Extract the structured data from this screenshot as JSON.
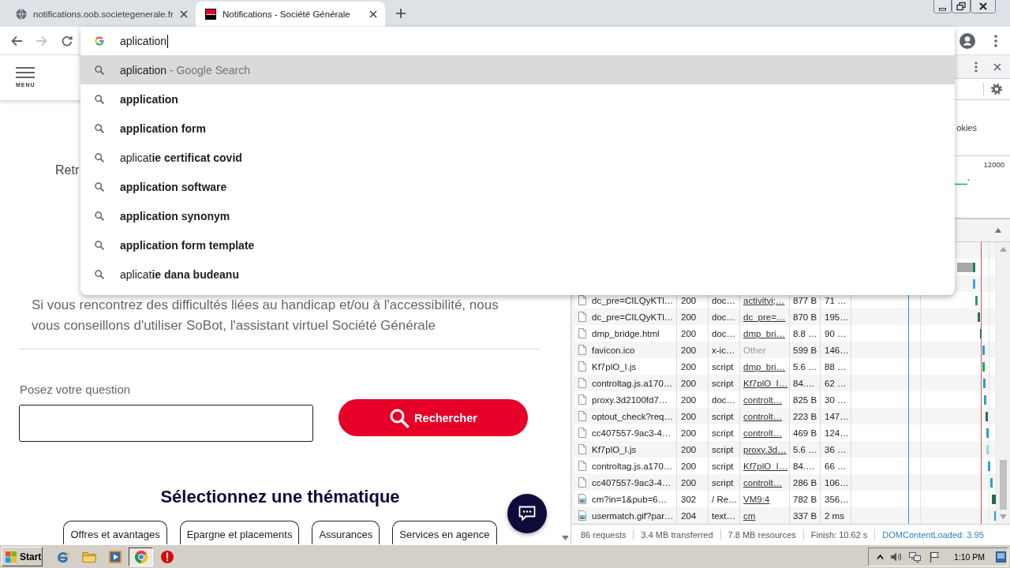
{
  "tabs": [
    {
      "title": "notifications.oob.societegenerale.fr",
      "selected": false
    },
    {
      "title": "Notifications - Société Générale",
      "selected": true
    }
  ],
  "toolbar": {
    "back_disabled": false,
    "forward_disabled": true
  },
  "omnibox": {
    "value": "aplication"
  },
  "suggestions": [
    {
      "kind": "query",
      "text": "aplication",
      "source": "- Google Search",
      "selected": true
    },
    {
      "kind": "completion",
      "text": "application",
      "selected": false
    },
    {
      "kind": "completion",
      "text": "application form",
      "selected": false
    },
    {
      "kind": "partial",
      "text": "aplicat**ie certificat covid**",
      "selected": false
    },
    {
      "kind": "completion",
      "text": "application software",
      "selected": false
    },
    {
      "kind": "completion",
      "text": "application synonym",
      "selected": false
    },
    {
      "kind": "completion",
      "text": "application form template",
      "selected": false
    },
    {
      "kind": "partial",
      "text": "aplicat**ie dana budeanu**",
      "selected": false
    }
  ],
  "page": {
    "menu_label": "MENU",
    "truncated_text": "Retr",
    "notice": "Si vous rencontrez des difficultés liées au handicap et/ou à l'accessibilité, nous vous conseillons d'utiliser SoBot, l'assistant virtuel Société Générale",
    "question_label": "Posez votre question",
    "search_button": "Rechercher",
    "themes_title": "Sélectionnez une thématique",
    "themes": [
      "Offres et avantages",
      "Epargne et placements",
      "Assurances",
      "Services en agence"
    ]
  },
  "devtools": {
    "filter_text": "okies",
    "overview_tick": "12000",
    "requests": [
      {
        "kind": "document",
        "name": "dc_pre=CILQyKTl…",
        "status": "200",
        "type": "doc…",
        "initiator": {
          "text": "activityi;…",
          "link": true
        },
        "size": "877 B",
        "time": "71 …"
      },
      {
        "kind": "document",
        "name": "dc_pre=CILQyKTl…",
        "status": "200",
        "type": "doc…",
        "initiator": {
          "text": "dc_pre=…",
          "link": true
        },
        "size": "870 B",
        "time": "195…"
      },
      {
        "kind": "document",
        "name": "dmp_bridge.html",
        "status": "200",
        "type": "doc…",
        "initiator": {
          "text": "dmp_bri…",
          "link": true
        },
        "size": "8.8 …",
        "time": "90 …"
      },
      {
        "kind": "document",
        "name": "favicon.ico",
        "status": "200",
        "type": "x-ic…",
        "initiator": {
          "text": "Other",
          "link": false
        },
        "size": "599 B",
        "time": "146…"
      },
      {
        "kind": "document",
        "name": "Kf7plO_I.js",
        "status": "200",
        "type": "script",
        "initiator": {
          "text": "dmp_bri…",
          "link": true
        },
        "size": "5.6 …",
        "time": "88 …"
      },
      {
        "kind": "document",
        "name": "controltag.js.a170…",
        "status": "200",
        "type": "script",
        "initiator": {
          "text": "Kf7plO_I…",
          "link": true
        },
        "size": "84.…",
        "time": "62 …"
      },
      {
        "kind": "document",
        "name": "proxy.3d2100fd7…",
        "status": "200",
        "type": "doc…",
        "initiator": {
          "text": "controlt…",
          "link": true
        },
        "size": "825 B",
        "time": "30 …"
      },
      {
        "kind": "document",
        "name": "optout_check?req…",
        "status": "200",
        "type": "script",
        "initiator": {
          "text": "controlt…",
          "link": true
        },
        "size": "223 B",
        "time": "147…"
      },
      {
        "kind": "document",
        "name": "cc407557-9ac3-4…",
        "status": "200",
        "type": "script",
        "initiator": {
          "text": "controlt…",
          "link": true
        },
        "size": "469 B",
        "time": "124…"
      },
      {
        "kind": "document",
        "name": "Kf7plO_I.js",
        "status": "200",
        "type": "script",
        "initiator": {
          "text": "proxy.3d…",
          "link": true
        },
        "size": "5.6 …",
        "time": "36 …"
      },
      {
        "kind": "document",
        "name": "controltag.js.a170…",
        "status": "200",
        "type": "script",
        "initiator": {
          "text": "Kf7plO_I…",
          "link": true
        },
        "size": "84.…",
        "time": "66 …"
      },
      {
        "kind": "document",
        "name": "cc407557-9ac3-4…",
        "status": "200",
        "type": "script",
        "initiator": {
          "text": "controlt…",
          "link": true
        },
        "size": "286 B",
        "time": "106…"
      },
      {
        "kind": "image",
        "name": "cm?in=1&pub=6…",
        "status": "302",
        "type": "/ Re…",
        "initiator": {
          "text": "VM9:4",
          "link": true
        },
        "size": "782 B",
        "time": "356…"
      },
      {
        "kind": "image",
        "name": "usermatch.gif?par…",
        "status": "204",
        "type": "text…",
        "initiator": {
          "text": "cm",
          "link": true
        },
        "size": "337 B",
        "time": "2 ms"
      }
    ],
    "summary": [
      {
        "kind": "stat",
        "text": "86 requests"
      },
      {
        "kind": "stat",
        "text": "3.4 MB transferred"
      },
      {
        "kind": "stat",
        "text": "7.8 MB resources"
      },
      {
        "kind": "stat",
        "text": "Finish: 10.62 s"
      },
      {
        "kind": "event",
        "text": "DOMContentLoaded: 3.95"
      }
    ]
  },
  "taskbar": {
    "start": "Start",
    "apps": [
      {
        "selected": false
      },
      {
        "selected": false
      },
      {
        "selected": false
      },
      {
        "selected": true
      },
      {
        "selected": false
      }
    ],
    "clock": "1:10 PM"
  }
}
